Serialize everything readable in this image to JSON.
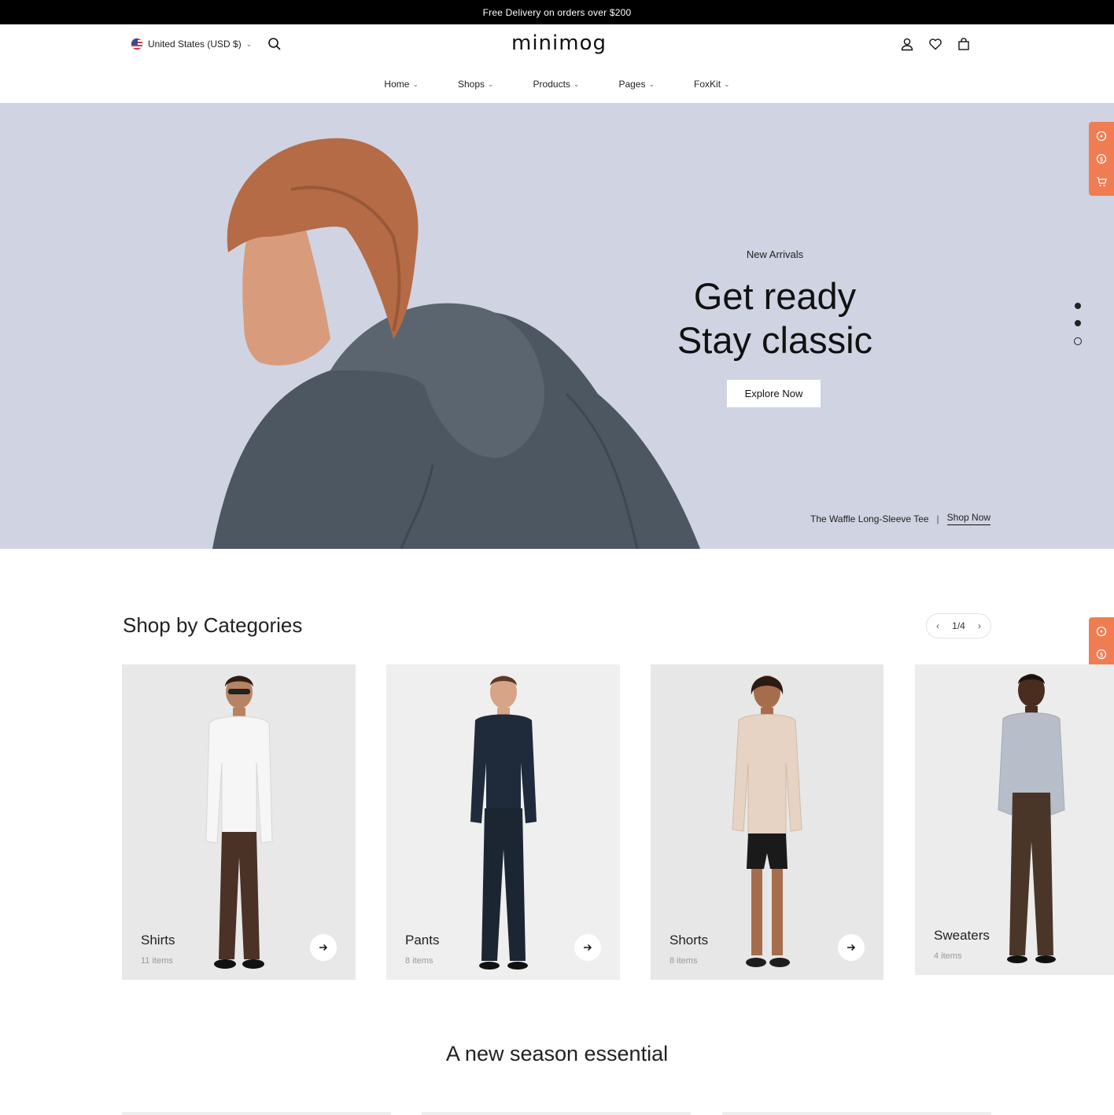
{
  "announcement": "Free Delivery on orders over $200",
  "header": {
    "locale": "United States (USD $)",
    "logo": "minimog",
    "icons": [
      "search-icon",
      "user-icon",
      "heart-icon",
      "bag-icon"
    ]
  },
  "nav": {
    "items": [
      {
        "label": "Home"
      },
      {
        "label": "Shops"
      },
      {
        "label": "Products"
      },
      {
        "label": "Pages"
      },
      {
        "label": "FoxKit"
      }
    ]
  },
  "hero": {
    "eyebrow": "New Arrivals",
    "headline_line1": "Get ready",
    "headline_line2": "Stay classic",
    "cta": "Explore Now",
    "product_name": "The Waffle Long-Sleeve Tee",
    "separator": "|",
    "product_link": "Shop Now",
    "slides": 3,
    "active_slide": 3
  },
  "categories": {
    "title": "Shop by Categories",
    "pager": "1/4",
    "items": [
      {
        "name": "Shirts",
        "count": "11 items",
        "top": "#ffffff",
        "bottom": "#4a3226"
      },
      {
        "name": "Pants",
        "count": "8 items",
        "top": "#1f2a3a",
        "bottom": "#1c2532"
      },
      {
        "name": "Shorts",
        "count": "8 items",
        "top": "#e6d3c3",
        "bottom": "#1a1a1a"
      },
      {
        "name": "Sweaters",
        "count": "4 items",
        "top": "#b7bec9",
        "bottom": "#4a3628"
      }
    ]
  },
  "season": {
    "title": "A new season essential"
  },
  "colors": {
    "hero_bg": "#d0d3e2",
    "accent": "#f07d52",
    "card_bg": "#ebebeb"
  }
}
